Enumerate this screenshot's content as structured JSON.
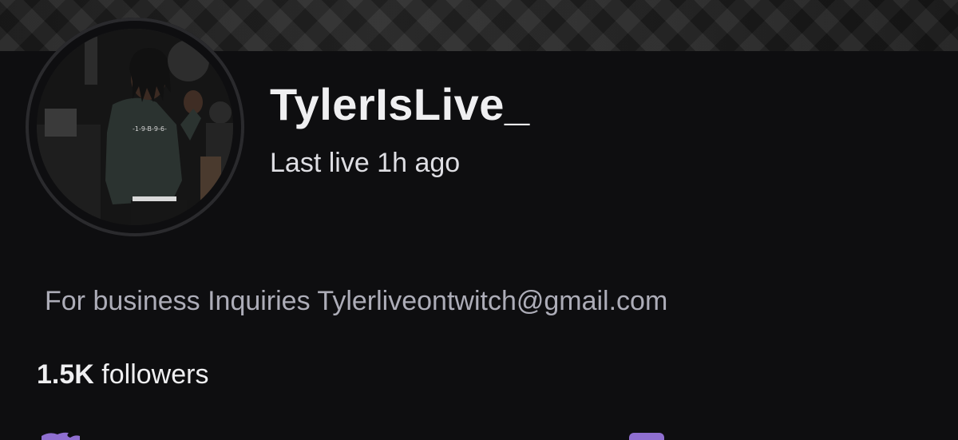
{
  "profile": {
    "display_name": "TylerIsLive_",
    "last_live": "Last live 1h ago",
    "bio": "For business Inquiries Tylerliveontwitch@gmail.com",
    "followers_count": "1.5K",
    "followers_label": "followers"
  },
  "colors": {
    "background": "#0e0e10",
    "text_primary": "#efeff1",
    "text_secondary": "#adadb8",
    "accent": "#9147ff"
  },
  "icons": {
    "bottom_left": "twitter-icon",
    "bottom_right": "social-link-icon"
  }
}
